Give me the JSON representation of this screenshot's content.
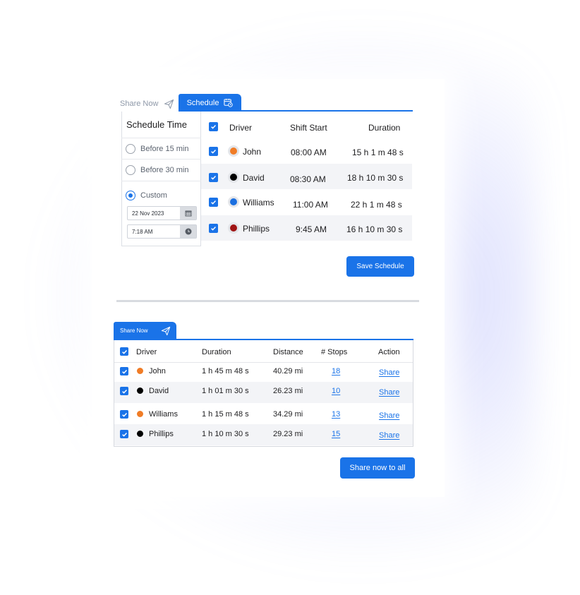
{
  "tabs": {
    "share_now": "Share Now",
    "schedule": "Schedule"
  },
  "schedule_panel": {
    "title": "Schedule Time",
    "options": [
      {
        "label": "Before 15 min",
        "selected": false
      },
      {
        "label": "Before 30 min",
        "selected": false
      },
      {
        "label": "Custom",
        "selected": true
      }
    ],
    "date_value": "22 Nov 2023",
    "time_value": "7:18 AM"
  },
  "schedule_table": {
    "headers": {
      "driver": "Driver",
      "shift_start": "Shift Start",
      "duration": "Duration"
    },
    "rows": [
      {
        "driver": "John",
        "color": "#f07c26",
        "shift_start": "08:00 AM",
        "duration": "15 h 1 m 48 s",
        "checked": true
      },
      {
        "driver": "David",
        "color": "#000000",
        "shift_start": "08:30 AM",
        "duration": "18 h 10 m 30 s",
        "checked": true
      },
      {
        "driver": "Williams",
        "color": "#1a6fe0",
        "shift_start": "11:00 AM",
        "duration": "22 h 1 m 48 s",
        "checked": true
      },
      {
        "driver": "Phillips",
        "color": "#a01414",
        "shift_start": "9:45 AM",
        "duration": "16 h 10 m 30 s",
        "checked": true
      }
    ],
    "save_label": "Save Schedule"
  },
  "share_now": {
    "tab_label": "Share Now",
    "headers": {
      "driver": "Driver",
      "duration": "Duration",
      "distance": "Distance",
      "stops": "# Stops",
      "action": "Action"
    },
    "rows": [
      {
        "driver": "John",
        "color": "#f07c26",
        "duration": "1 h 45 m 48 s",
        "distance": "40.29 mi",
        "stops": "18",
        "action": "Share"
      },
      {
        "driver": "David",
        "color": "#000000",
        "duration": "1 h 01 m 30 s",
        "distance": "26.23 mi",
        "stops": "10",
        "action": "Share"
      },
      {
        "driver": "Williams",
        "color": "#f07c26",
        "duration": "1 h 15 m 48 s",
        "distance": "34.29 mi",
        "stops": "13",
        "action": "Share"
      },
      {
        "driver": "Phillips",
        "color": "#000000",
        "duration": "1 h 10 m 30 s",
        "distance": "29.23 mi",
        "stops": "15",
        "action": "Share"
      }
    ],
    "share_all_label": "Share now to all"
  },
  "colors": {
    "accent": "#1a73e8"
  },
  "icons": {
    "share": "paper-plane-icon",
    "schedule": "calendar-clock-icon",
    "date": "calendar-icon",
    "time": "clock-icon",
    "check": "checkmark-icon"
  }
}
